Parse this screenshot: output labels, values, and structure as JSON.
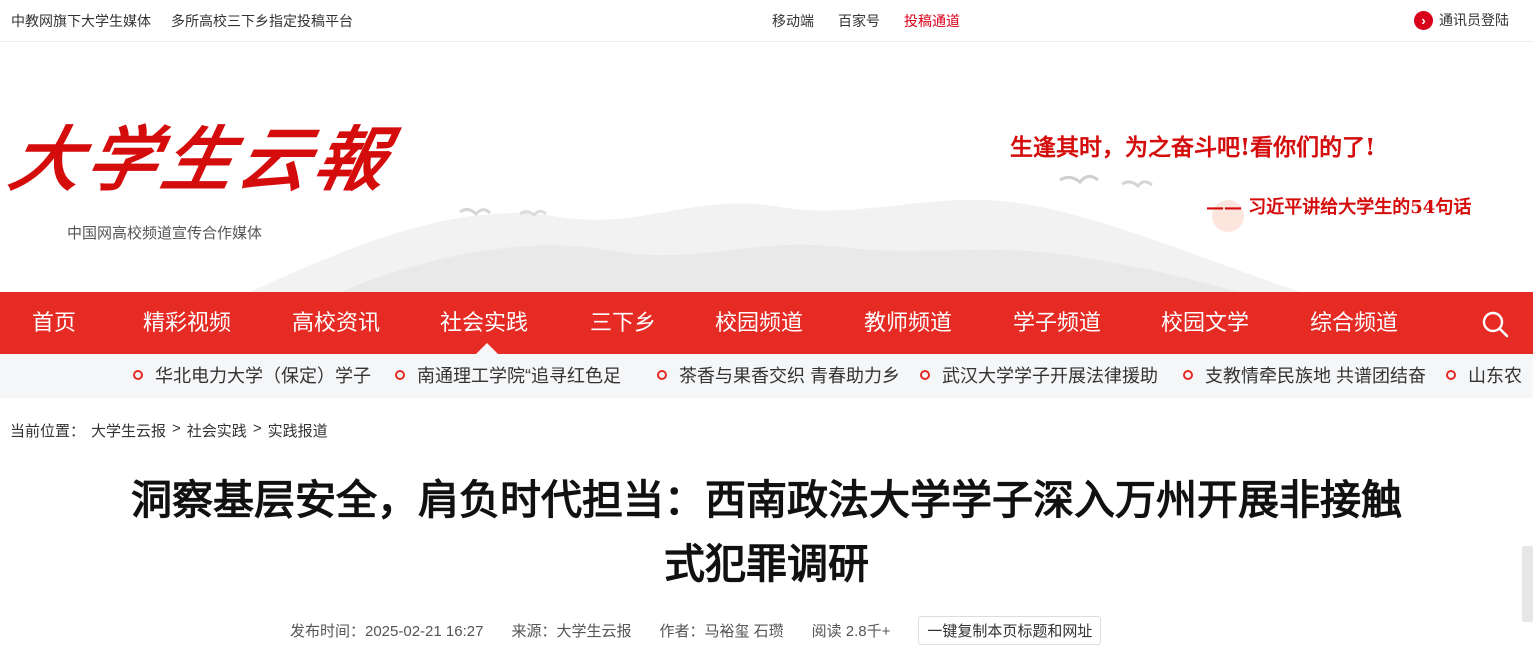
{
  "topbar": {
    "left_links": [
      "中教网旗下大学生媒体",
      "多所高校三下乡指定投稿平台"
    ],
    "center_links": [
      "移动端",
      "百家号",
      "投稿通道"
    ],
    "login_label": "通讯员登陆"
  },
  "header": {
    "logo_text": "大学生云报",
    "logo_subtitle": "中国网高校频道宣传合作媒体",
    "slogan": "生逢其时，为之奋斗吧!看你们的了!",
    "slogan_sub": "—— 习近平讲给大学生的54句话"
  },
  "nav": {
    "items": [
      "首页",
      "精彩视频",
      "高校资讯",
      "社会实践",
      "三下乡",
      "校园频道",
      "教师频道",
      "学子频道",
      "校园文学",
      "综合频道"
    ],
    "active_index": 3
  },
  "ticker": {
    "items": [
      "华北电力大学（保定）学子",
      "南通理工学院“追寻红色足",
      "茶香与果香交织 青春助力乡",
      "武汉大学学子开展法律援助",
      "支教情牵民族地 共谱团结奋",
      "山东农"
    ]
  },
  "breadcrumb": {
    "label": "当前位置：",
    "items": [
      "大学生云报",
      "社会实践",
      "实践报道"
    ],
    "separator": ">"
  },
  "article": {
    "title_line1": "洞察基层安全，肩负时代担当：西南政法大学学子深入万州开展非接触",
    "title_line2": "式犯罪调研",
    "publish_time": "发布时间：2025-02-21 16:27",
    "source": "来源：大学生云报",
    "author": "作者：马裕玺 石瓒",
    "reads": "阅读 2.8千+",
    "copy_button": "一键复制本页标题和网址"
  },
  "colors": {
    "brand_red": "#e52b24",
    "logo_red": "#d40c0c",
    "ticker_bg": "#f5f6f8"
  },
  "icons": [
    "arrow-right-circle-icon",
    "search-icon",
    "ring-dot-icon"
  ]
}
